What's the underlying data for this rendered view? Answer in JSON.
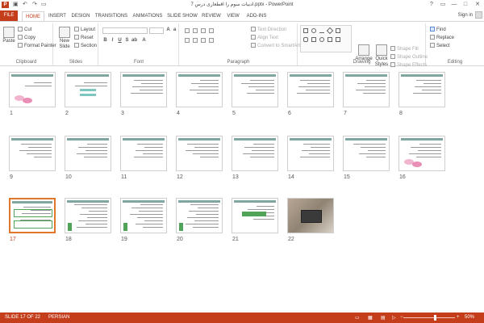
{
  "window": {
    "title": "ادبیات سوم را اقطعاری درس 7.pptx - PowerPoint",
    "app_icon": "P",
    "qat": {
      "save": "save-icon",
      "undo": "undo-icon",
      "redo": "redo-icon"
    },
    "controls": {
      "help": "?",
      "restore": "▭",
      "minimize": "—",
      "maximize": "□",
      "close": "✕"
    }
  },
  "tabs": [
    {
      "label": "FILE"
    },
    {
      "label": "HOME"
    },
    {
      "label": "INSERT"
    },
    {
      "label": "DESIGN"
    },
    {
      "label": "TRANSITIONS"
    },
    {
      "label": "ANIMATIONS"
    },
    {
      "label": "SLIDE SHOW"
    },
    {
      "label": "REVIEW"
    },
    {
      "label": "VIEW"
    },
    {
      "label": "ADD-INS"
    }
  ],
  "account": {
    "signin": "Sign in"
  },
  "ribbon": {
    "clipboard": {
      "label": "Clipboard",
      "paste": "Paste",
      "cut": "Cut",
      "copy": "Copy",
      "format_painter": "Format Painter"
    },
    "slides": {
      "label": "Slides",
      "new_slide": "New Slide",
      "layout": "Layout",
      "reset": "Reset",
      "section": "Section"
    },
    "font": {
      "label": "Font"
    },
    "paragraph": {
      "label": "Paragraph",
      "text_direction": "Text Direction",
      "align_text": "Align Text",
      "convert_smartart": "Convert to SmartArt"
    },
    "drawing": {
      "label": "Drawing",
      "arrange": "Arrange",
      "quick_styles": "Quick Styles",
      "shape_fill": "Shape Fill",
      "shape_outline": "Shape Outline",
      "shape_effects": "Shape Effects"
    },
    "editing": {
      "label": "Editing",
      "find": "Find",
      "replace": "Replace",
      "select": "Select"
    }
  },
  "slides": [
    {
      "num": "1",
      "kind": "title-flower"
    },
    {
      "num": "2",
      "kind": "title-teal"
    },
    {
      "num": "3",
      "kind": "text"
    },
    {
      "num": "4",
      "kind": "text"
    },
    {
      "num": "5",
      "kind": "text"
    },
    {
      "num": "6",
      "kind": "text"
    },
    {
      "num": "7",
      "kind": "text"
    },
    {
      "num": "8",
      "kind": "text"
    },
    {
      "num": "9",
      "kind": "text"
    },
    {
      "num": "10",
      "kind": "text"
    },
    {
      "num": "11",
      "kind": "text"
    },
    {
      "num": "12",
      "kind": "text"
    },
    {
      "num": "13",
      "kind": "text"
    },
    {
      "num": "14",
      "kind": "text"
    },
    {
      "num": "15",
      "kind": "text"
    },
    {
      "num": "16",
      "kind": "text-flower"
    },
    {
      "num": "17",
      "kind": "green-box",
      "selected": true
    },
    {
      "num": "18",
      "kind": "dense"
    },
    {
      "num": "19",
      "kind": "dense"
    },
    {
      "num": "20",
      "kind": "dense"
    },
    {
      "num": "21",
      "kind": "green-text"
    },
    {
      "num": "22",
      "kind": "photo"
    }
  ],
  "status": {
    "slide_info": "SLIDE 17 OF 22",
    "language": "PERSIAN",
    "zoom": "50%",
    "zoom_minus": "−",
    "zoom_plus": "+"
  },
  "colors": {
    "accent": "#c43e1c",
    "selection": "#e2772c"
  }
}
